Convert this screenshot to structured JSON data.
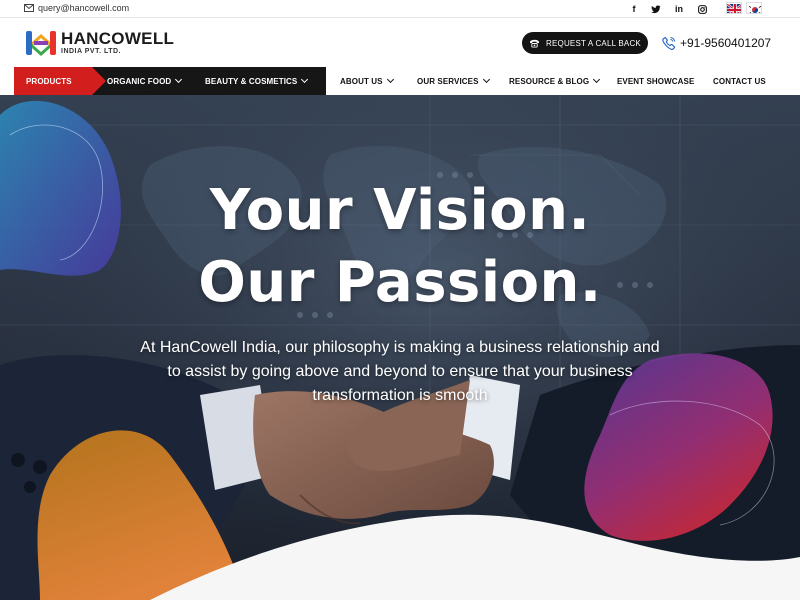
{
  "topbar": {
    "email": "query@hancowell.com",
    "social_icons": [
      "facebook-icon",
      "twitter-icon",
      "linkedin-icon",
      "instagram-icon"
    ],
    "languages": [
      "uk-flag",
      "korea-flag"
    ]
  },
  "header": {
    "brand_name": "HANCOWELL",
    "brand_sub": "INDIA PVT. LTD.",
    "call_button": "REQUEST A CALL BACK",
    "phone": "+91-9560401207"
  },
  "nav": {
    "items": [
      {
        "label": "PRODUCTS",
        "dropdown": false
      },
      {
        "label": "ORGANIC FOOD",
        "dropdown": true
      },
      {
        "label": "BEAUTY & COSMETICS",
        "dropdown": true
      },
      {
        "label": "ABOUT US",
        "dropdown": true
      },
      {
        "label": "OUR SERVICES",
        "dropdown": true
      },
      {
        "label": "RESOURCE & BLOG",
        "dropdown": true
      },
      {
        "label": "EVENT SHOWCASE",
        "dropdown": false
      },
      {
        "label": "CONTACT US",
        "dropdown": false
      }
    ]
  },
  "hero": {
    "headline_1": "Your Vision.",
    "headline_2": "Our Passion.",
    "tagline": "At HanCowell India, our philosophy is making a business relationship and to assist by going above and beyond to ensure that your business transformation is smooth"
  },
  "colors": {
    "accent_red": "#d31e1e",
    "nav_dark": "#161616",
    "button_dark": "#141414"
  }
}
